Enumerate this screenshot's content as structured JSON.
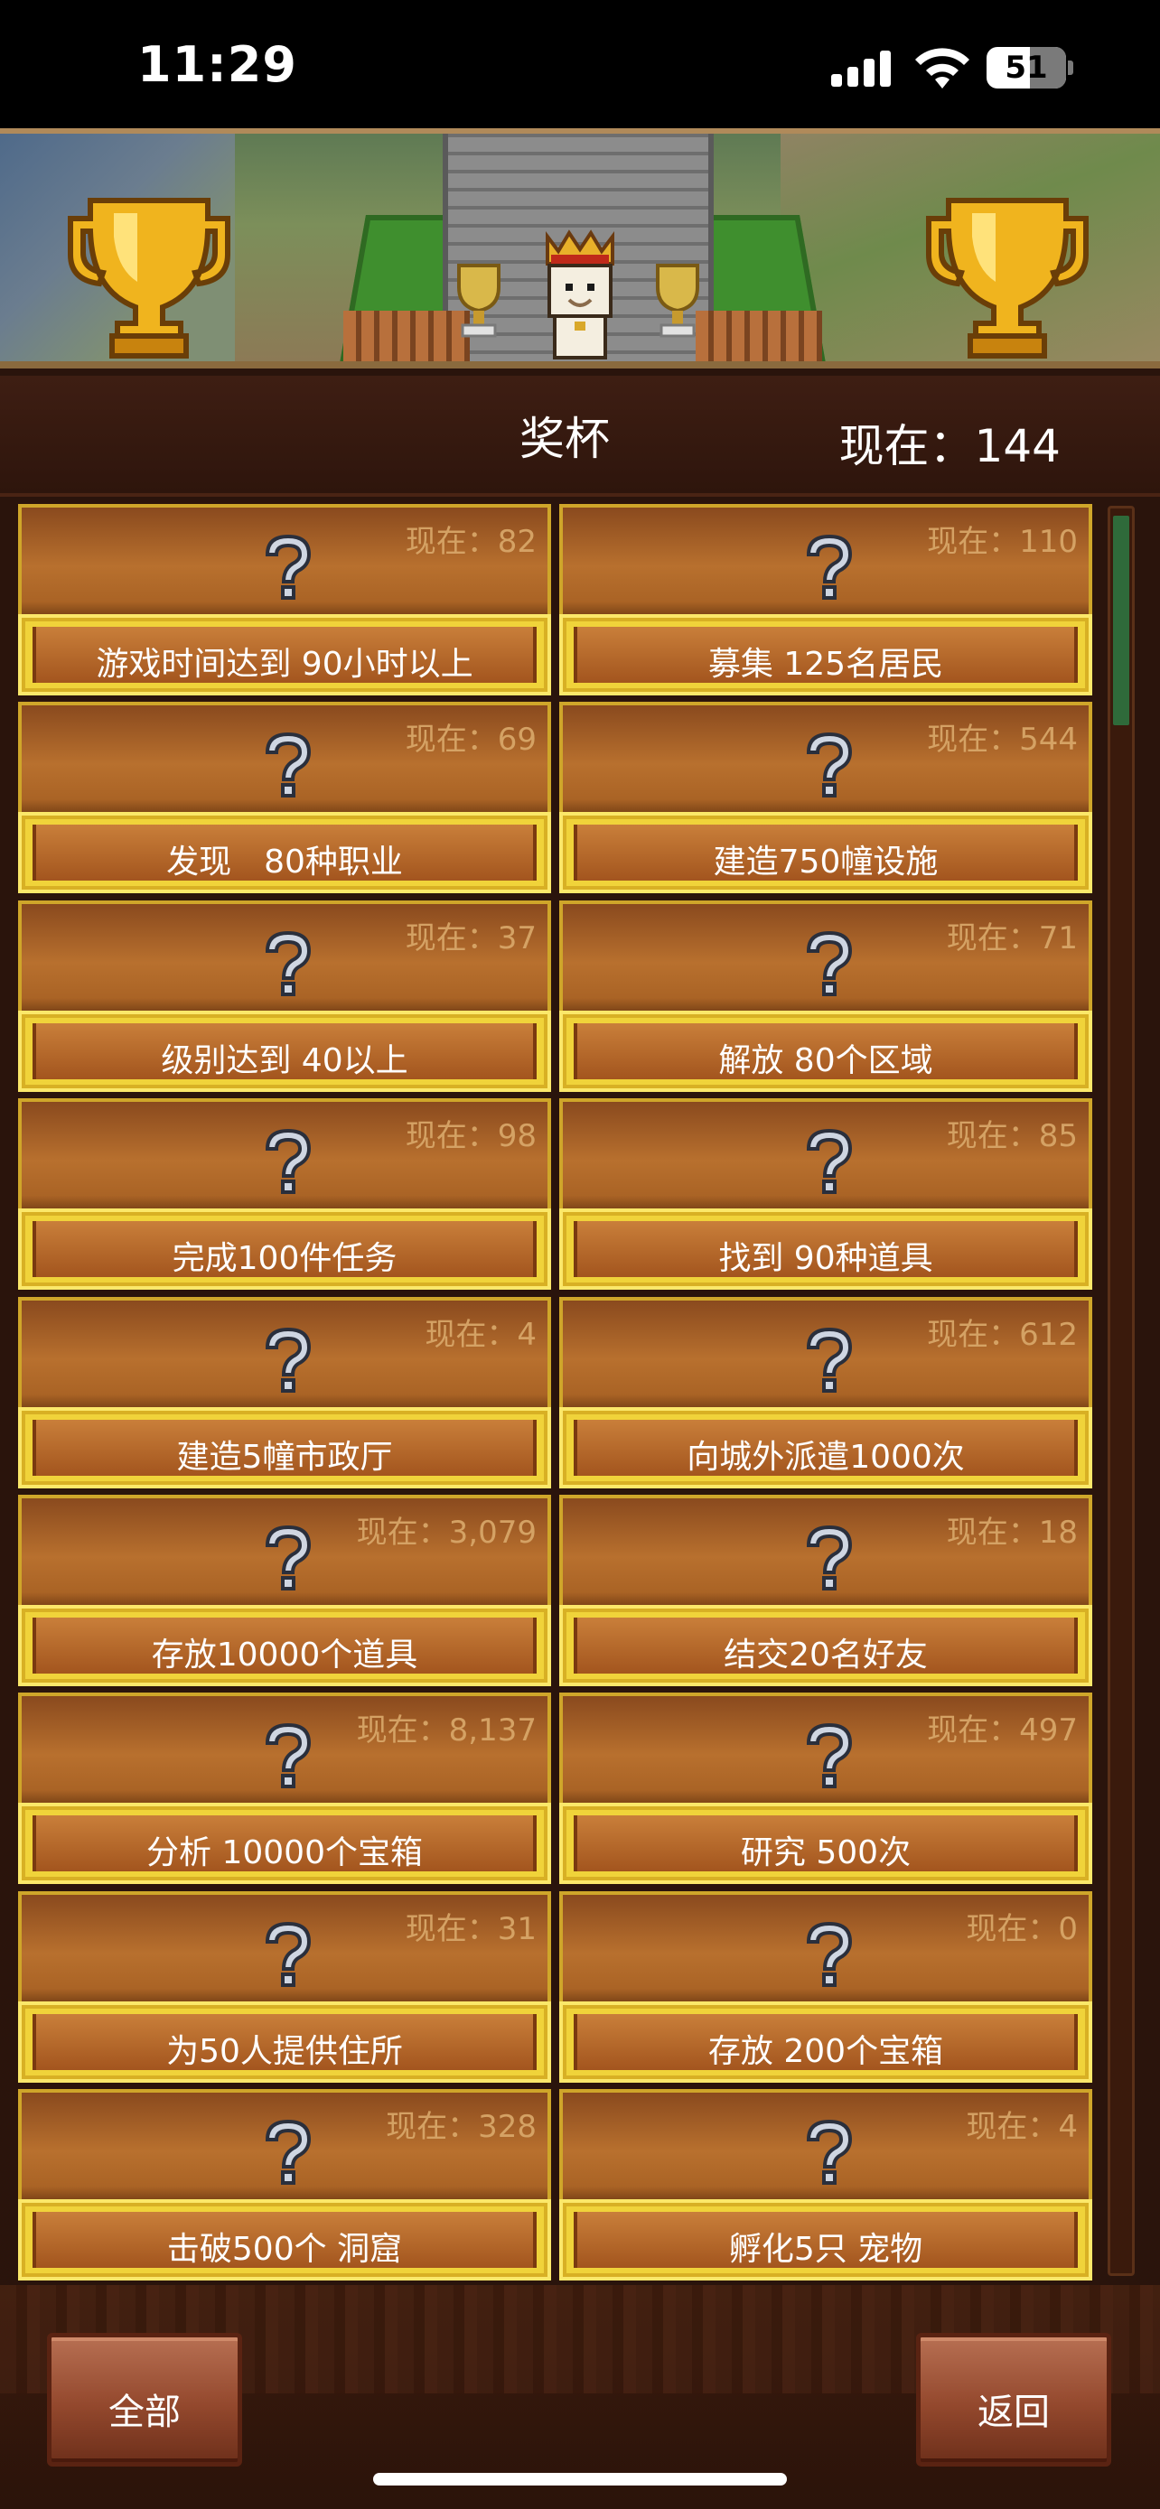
{
  "status_bar": {
    "time": "11:29",
    "battery": "51"
  },
  "header": {
    "title": "奖杯",
    "total": "现在：144"
  },
  "achievements": [
    {
      "label": "游戏时间达到 90小时以上",
      "count": "现在：82"
    },
    {
      "label": "募集 125名居民",
      "count": "现在：110"
    },
    {
      "label": "发现　80种职业",
      "count": "现在：69"
    },
    {
      "label": "建造750幢设施",
      "count": "现在：544"
    },
    {
      "label": "级别达到 40以上",
      "count": "现在：37"
    },
    {
      "label": "解放 80个区域",
      "count": "现在：71"
    },
    {
      "label": "完成100件任务",
      "count": "现在：98"
    },
    {
      "label": "找到 90种道具",
      "count": "现在：85"
    },
    {
      "label": "建造5幢市政厅",
      "count": "现在：4"
    },
    {
      "label": "向城外派遣1000次",
      "count": "现在：612"
    },
    {
      "label": "存放10000个道具",
      "count": "现在：3,079"
    },
    {
      "label": "结交20名好友",
      "count": "现在：18"
    },
    {
      "label": "分析 10000个宝箱",
      "count": "现在：8,137"
    },
    {
      "label": "研究 500次",
      "count": "现在：497"
    },
    {
      "label": "为50人提供住所",
      "count": "现在：31"
    },
    {
      "label": "存放 200个宝箱",
      "count": "现在：0"
    },
    {
      "label": "击破500个 洞窟",
      "count": "现在：328"
    },
    {
      "label": "孵化5只 宠物",
      "count": "现在：4"
    }
  ],
  "footer": {
    "all_label": "全部",
    "back_label": "返回"
  },
  "icons": {
    "locked": "question-mark-icon",
    "banner": "trophy-icon"
  },
  "colors": {
    "card_gold": "#f0d33a",
    "card_brown": "#b8702e",
    "background": "#2a140c"
  }
}
